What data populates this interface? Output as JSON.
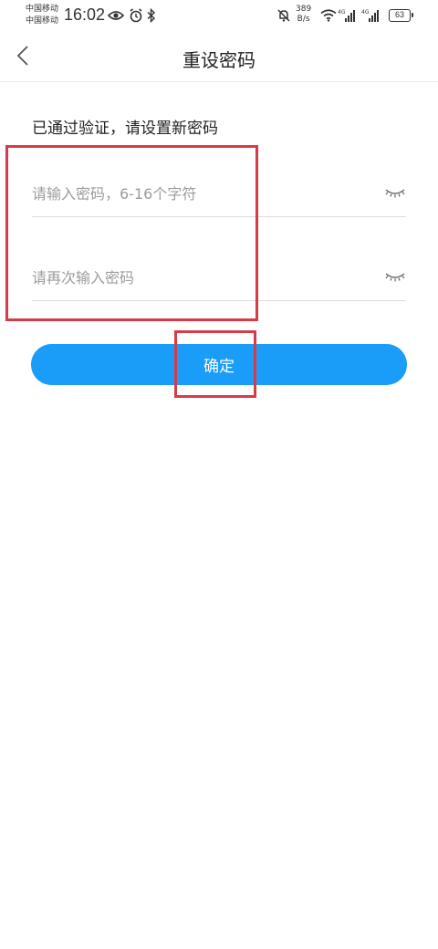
{
  "status_bar": {
    "carrier_1": "中国移动",
    "carrier_2": "中国移动",
    "time": "16:02",
    "net_speed_value": "389",
    "net_speed_unit": "B/s",
    "signal_1_label": "4G",
    "signal_2_label": "4G",
    "battery": "63",
    "icons": [
      "eye-icon",
      "alarm-icon",
      "bluetooth-icon",
      "mute-bell-icon",
      "wifi-icon",
      "signal-icon",
      "signal-icon",
      "battery-icon"
    ]
  },
  "nav": {
    "title": "重设密码",
    "back_icon": "chevron-left-icon"
  },
  "form": {
    "subtitle": "已通过验证，请设置新密码",
    "password": {
      "placeholder": "请输入密码，6-16个字符",
      "value": ""
    },
    "confirm_password": {
      "placeholder": "请再次输入密码",
      "value": ""
    },
    "toggle_icon": "closed-eye-icon",
    "submit_label": "确定"
  },
  "colors": {
    "primary": "#1a9cf9",
    "highlight": "#d93a48",
    "placeholder": "#9c9c9c",
    "divider": "#dddddd"
  }
}
